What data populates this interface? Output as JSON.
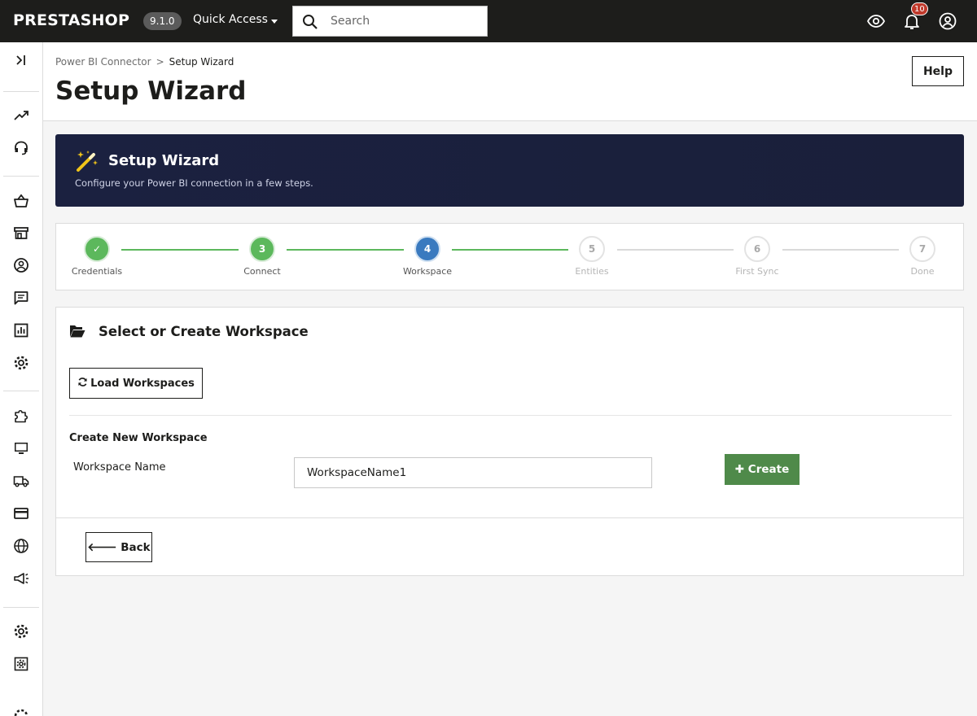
{
  "topbar": {
    "logo": "PRESTASHOP",
    "version": "9.1.0",
    "quick_access": "Quick Access",
    "search_placeholder": "Search",
    "notification_count": "10",
    "icons": [
      "eye-icon",
      "bell-icon",
      "user-circle-icon"
    ]
  },
  "sidebar": {
    "icons": [
      "collapse-icon",
      "trending-up-icon",
      "headset-icon",
      "basket-icon",
      "store-icon",
      "customer-icon",
      "message-icon",
      "stats-icon",
      "settings-gear-icon",
      "puzzle-icon",
      "monitor-icon",
      "truck-icon",
      "credit-card-icon",
      "globe-icon",
      "megaphone-icon",
      "gear-icon",
      "settings-box-icon"
    ]
  },
  "header": {
    "breadcrumb_parent": "Power BI Connector",
    "breadcrumb_separator": ">",
    "breadcrumb_current": "Setup Wizard",
    "title": "Setup Wizard",
    "help_label": "Help"
  },
  "banner": {
    "title": "Setup Wizard",
    "subtitle": "Configure your Power BI connection in a few steps.",
    "icon": "magic-wand-icon"
  },
  "stepper": {
    "steps": [
      {
        "number": "✓",
        "label": "Credentials",
        "state": "done"
      },
      {
        "number": "3",
        "label": "Connect",
        "state": "done"
      },
      {
        "number": "4",
        "label": "Workspace",
        "state": "active"
      },
      {
        "number": "5",
        "label": "Entities",
        "state": "pending"
      },
      {
        "number": "6",
        "label": "First Sync",
        "state": "pending"
      },
      {
        "number": "7",
        "label": "Done",
        "state": "pending"
      }
    ],
    "colors": {
      "done": "#5cb85c",
      "active": "#3a7abf",
      "pending": "#a9a9a9"
    }
  },
  "workspace_card": {
    "title": "Select or Create Workspace",
    "icon": "folder-open-icon",
    "load_label": "Load Workspaces",
    "create_heading": "Create New Workspace",
    "name_label": "Workspace Name",
    "name_value": "WorkspaceName1",
    "create_label": "Create",
    "back_label": "Back"
  }
}
